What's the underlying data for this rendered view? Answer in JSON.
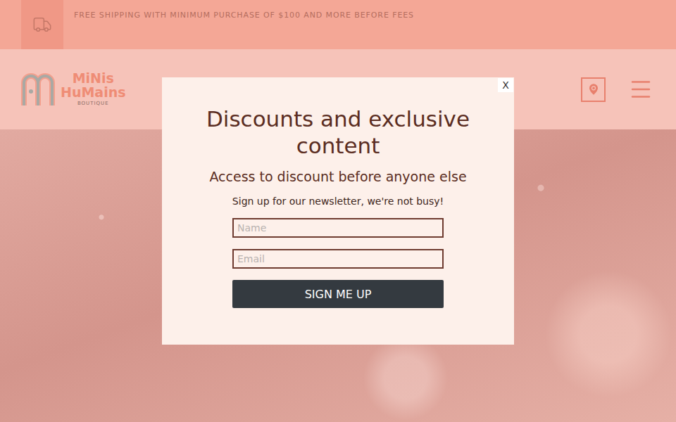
{
  "announcement": {
    "text": "FREE SHIPPING WITH MINIMUM PURCHASE OF $100 AND MORE BEFORE FEES"
  },
  "logo": {
    "line1": "MiNis",
    "line2": "HuMains",
    "tagline": "BOUTIQUE"
  },
  "modal": {
    "close": "X",
    "title": "Discounts and exclusive content",
    "subtitle": "Access to discount before anyone else",
    "note": "Sign up for our newsletter, we're not busy!",
    "fields": [
      {
        "placeholder": "Name"
      },
      {
        "placeholder": "Email"
      }
    ],
    "button": "SIGN ME UP"
  }
}
